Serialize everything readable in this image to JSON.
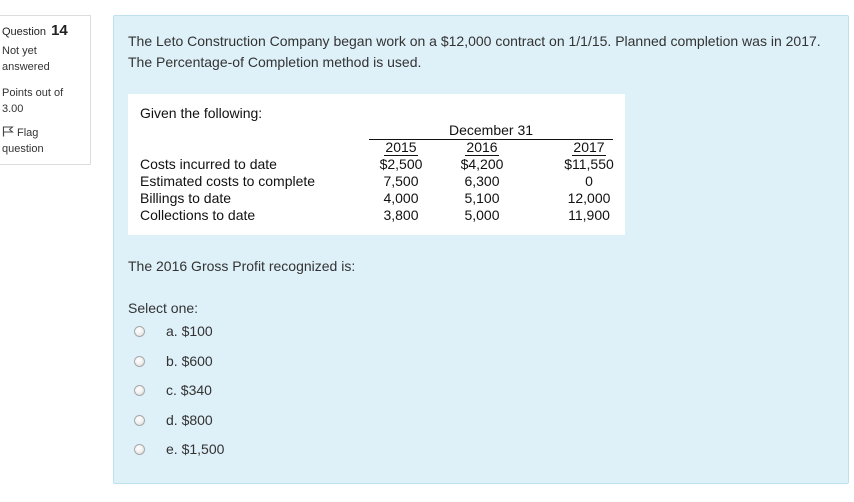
{
  "info": {
    "question_label": "Question",
    "question_number": "14",
    "state": "Not yet answered",
    "grade": "Points out of 3.00",
    "flag_label": "Flag question"
  },
  "question": {
    "text": "The Leto Construction Company began work on a $12,000 contract on 1/1/15. Planned completion was in 2017. The Percentage-of Completion method is used.",
    "given_title": "Given the following:",
    "header": "December 31",
    "years": [
      "2015",
      "2016",
      "2017"
    ],
    "rows": [
      {
        "label": "Costs incurred to date",
        "values": [
          "$2,500",
          "$4,200",
          "$11,550"
        ]
      },
      {
        "label": "Estimated costs to complete",
        "values": [
          "7,500",
          "6,300",
          "0"
        ]
      },
      {
        "label": "Billings to date",
        "values": [
          "4,000",
          "5,100",
          "12,000"
        ]
      },
      {
        "label": "Collections to date",
        "values": [
          "3,800",
          "5,000",
          "11,900"
        ]
      }
    ],
    "prompt": "The 2016 Gross Profit recognized is:"
  },
  "answer": {
    "select_label": "Select one:",
    "options": [
      "a. $100",
      "b. $600",
      "c. $340",
      "d. $800",
      "e. $1,500"
    ]
  }
}
